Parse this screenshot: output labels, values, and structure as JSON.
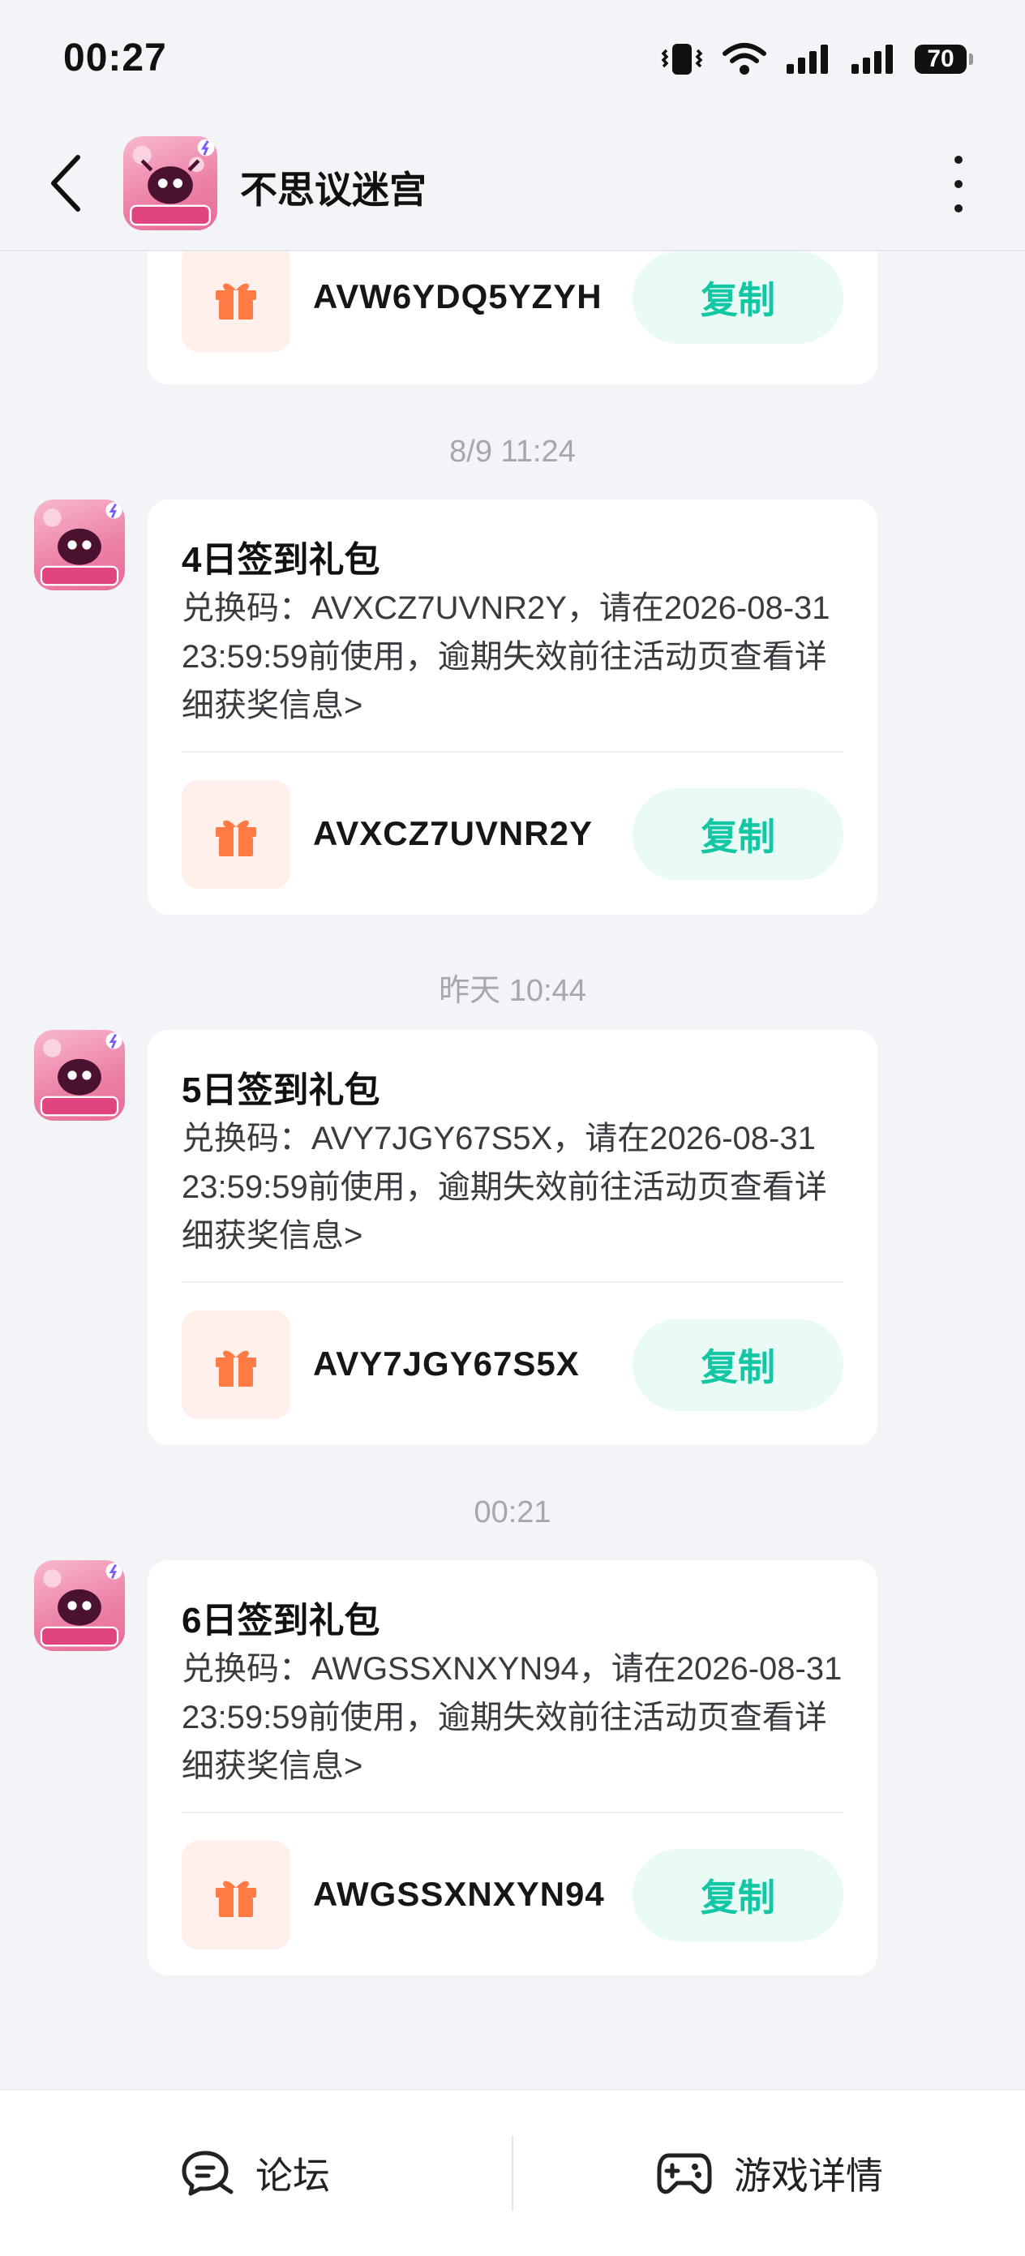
{
  "status_bar": {
    "time": "00:27",
    "battery": "70"
  },
  "header": {
    "title": "不思议迷宫",
    "avatar_badge": "闪爆节"
  },
  "messages": [
    {
      "timestamp": "",
      "title": "",
      "desc": "",
      "code": "AVW6YDQ5YZYH",
      "copy_label": "复制"
    },
    {
      "timestamp": "8/9  11:24",
      "title": "4日签到礼包",
      "desc": "兑换码：AVXCZ7UVNR2Y，请在2026-08-31 23:59:59前使用，逾期失效前往活动页查看详细获奖信息>",
      "code": "AVXCZ7UVNR2Y",
      "copy_label": "复制"
    },
    {
      "timestamp": "昨天  10:44",
      "title": "5日签到礼包",
      "desc": "兑换码：AVY7JGY67S5X，请在2026-08-31 23:59:59前使用，逾期失效前往活动页查看详细获奖信息>",
      "code": "AVY7JGY67S5X",
      "copy_label": "复制"
    },
    {
      "timestamp": "00:21",
      "title": "6日签到礼包",
      "desc": "兑换码：AWGSSXNXYN94，请在2026-08-31 23:59:59前使用，逾期失效前往活动页查看详细获奖信息>",
      "code": "AWGSSXNXYN94",
      "copy_label": "复制"
    }
  ],
  "bottom_bar": {
    "forum_label": "论坛",
    "game_details_label": "游戏详情"
  },
  "icons": {
    "back": "chevron-left-icon",
    "more": "more-vertical-icon",
    "gift": "gift-icon",
    "forum": "chat-bubble-icon",
    "game": "gamepad-icon"
  },
  "colors": {
    "accent": "#14c7a4",
    "copy_bg": "#eafbf6",
    "gift": "#ff7a45",
    "gift_bg": "#fff0ec"
  }
}
